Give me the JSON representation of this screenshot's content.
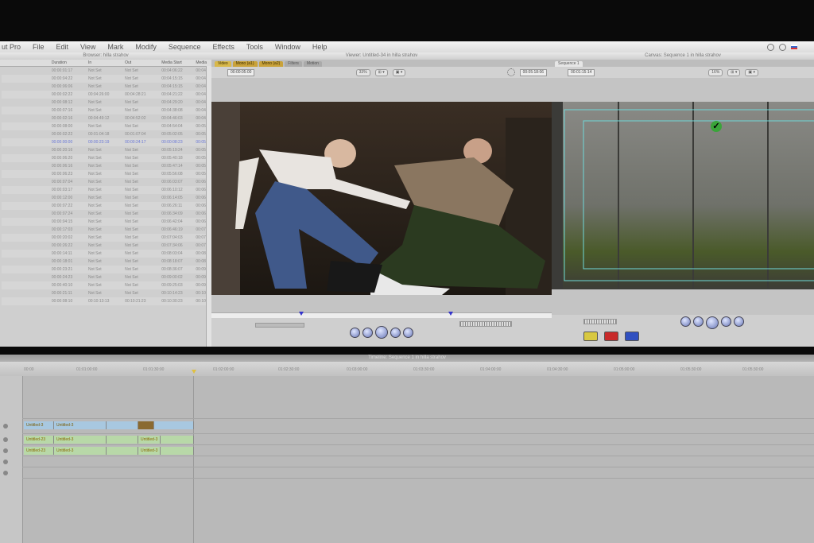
{
  "menubar": {
    "app_name": "ut Pro",
    "items": [
      "File",
      "Edit",
      "View",
      "Mark",
      "Modify",
      "Sequence",
      "Effects",
      "Tools",
      "Window",
      "Help"
    ]
  },
  "browser": {
    "title": "Browser: hilla strahov",
    "columns": [
      "Duration",
      "In",
      "Out",
      "Media Start",
      "Media"
    ],
    "rows": [
      [
        "00:00:01:17",
        "Not Set",
        "Not Set",
        "00:04:06:22",
        "00:04"
      ],
      [
        "00:00:04:22",
        "Not Set",
        "Not Set",
        "00:04:15:15",
        "00:04"
      ],
      [
        "00:00:06:06",
        "Not Set",
        "Not Set",
        "00:04:15:15",
        "00:04"
      ],
      [
        "00:00:02:22",
        "00:04:26:00",
        "00:04:28:21",
        "00:04:21:22",
        "00:04"
      ],
      [
        "00:00:08:12",
        "Not Set",
        "Not Set",
        "00:04:29:20",
        "00:04"
      ],
      [
        "00:00:07:16",
        "Not Set",
        "Not Set",
        "00:04:38:08",
        "00:04"
      ],
      [
        "00:00:02:16",
        "00:04:49:12",
        "00:04:52:02",
        "00:04:46:03",
        "00:04"
      ],
      [
        "00:00:08:00",
        "Not Set",
        "Not Set",
        "00:04:54:04",
        "00:05"
      ],
      [
        "00:00:02:22",
        "00:01:04:18",
        "00:01:07:04",
        "00:05:02:05",
        "00:05"
      ],
      [
        "00:00:00:00",
        "00:00:23:19",
        "00:00:24:17",
        "00:00:08:23",
        "00:05"
      ],
      [
        "00:00:20:16",
        "Not Set",
        "Not Set",
        "00:05:19:24",
        "00:05"
      ],
      [
        "00:00:06:20",
        "Not Set",
        "Not Set",
        "00:05:40:18",
        "00:05"
      ],
      [
        "00:00:06:16",
        "Not Set",
        "Not Set",
        "00:05:47:14",
        "00:05"
      ],
      [
        "00:00:06:23",
        "Not Set",
        "Not Set",
        "00:05:56:08",
        "00:05"
      ],
      [
        "00:00:07:04",
        "Not Set",
        "Not Set",
        "00:06:03:07",
        "00:06"
      ],
      [
        "00:00:03:17",
        "Not Set",
        "Not Set",
        "00:06:10:12",
        "00:06"
      ],
      [
        "00:00:12:00",
        "Not Set",
        "Not Set",
        "00:06:14:05",
        "00:06"
      ],
      [
        "00:00:07:22",
        "Not Set",
        "Not Set",
        "00:06:26:11",
        "00:06"
      ],
      [
        "00:00:07:24",
        "Not Set",
        "Not Set",
        "00:06:34:09",
        "00:06"
      ],
      [
        "00:00:04:15",
        "Not Set",
        "Not Set",
        "00:06:42:04",
        "00:06"
      ],
      [
        "00:00:17:03",
        "Not Set",
        "Not Set",
        "00:06:46:19",
        "00:07"
      ],
      [
        "00:00:20:02",
        "Not Set",
        "Not Set",
        "00:07:04:03",
        "00:07"
      ],
      [
        "00:00:26:22",
        "Not Set",
        "Not Set",
        "00:07:34:06",
        "00:07"
      ],
      [
        "00:00:14:11",
        "Not Set",
        "Not Set",
        "00:08:03:04",
        "00:08"
      ],
      [
        "00:00:18:01",
        "Not Set",
        "Not Set",
        "00:08:18:07",
        "00:08"
      ],
      [
        "00:00:23:21",
        "Not Set",
        "Not Set",
        "00:08:36:07",
        "00:09"
      ],
      [
        "00:00:24:23",
        "Not Set",
        "Not Set",
        "00:09:00:02",
        "00:09"
      ],
      [
        "00:00:40:10",
        "Not Set",
        "Not Set",
        "00:09:25:03",
        "00:09"
      ],
      [
        "00:00:21:11",
        "Not Set",
        "Not Set",
        "00:10:14:23",
        "00:10"
      ],
      [
        "00:00:08:10",
        "00:10:13:13",
        "00:10:21:23",
        "00:10:30:23",
        "00:10"
      ]
    ],
    "selected_row": 9
  },
  "viewer": {
    "title": "Viewer: Untitled-34 in hilla strahov",
    "tabs": [
      "Video",
      "Mono (a1)",
      "Mono (a2)",
      "Filters",
      "Motion"
    ],
    "timecode_left": "00:00:05:00",
    "zoom": "33%",
    "timecode_right": "00:05:18:06"
  },
  "canvas": {
    "title": "Canvas: Sequence 1 in hilla strahov",
    "tab": "Sequence 1",
    "timecode": "00:01:15:14",
    "zoom": "16%"
  },
  "timeline": {
    "title": "Timeline: Sequence 1 in hilla strahov",
    "ruler_labels": [
      "00:00",
      "01:01:00:00",
      "01:01:30:00",
      "01:02:00:00",
      "01:02:30:00",
      "01:03:00:00",
      "01:03:30:00",
      "01:04:00:00",
      "01:04:30:00",
      "01:05:00:00",
      "01:05:30:00"
    ],
    "clip_name": "Untitled-3",
    "audio_clip_name": "Untitled-23"
  },
  "colors": {
    "accent_tab": "#d8b84a",
    "overlay": "#6fd8d8",
    "video_clip": "#a8c8e0",
    "audio_clip": "#b8d8a8"
  }
}
